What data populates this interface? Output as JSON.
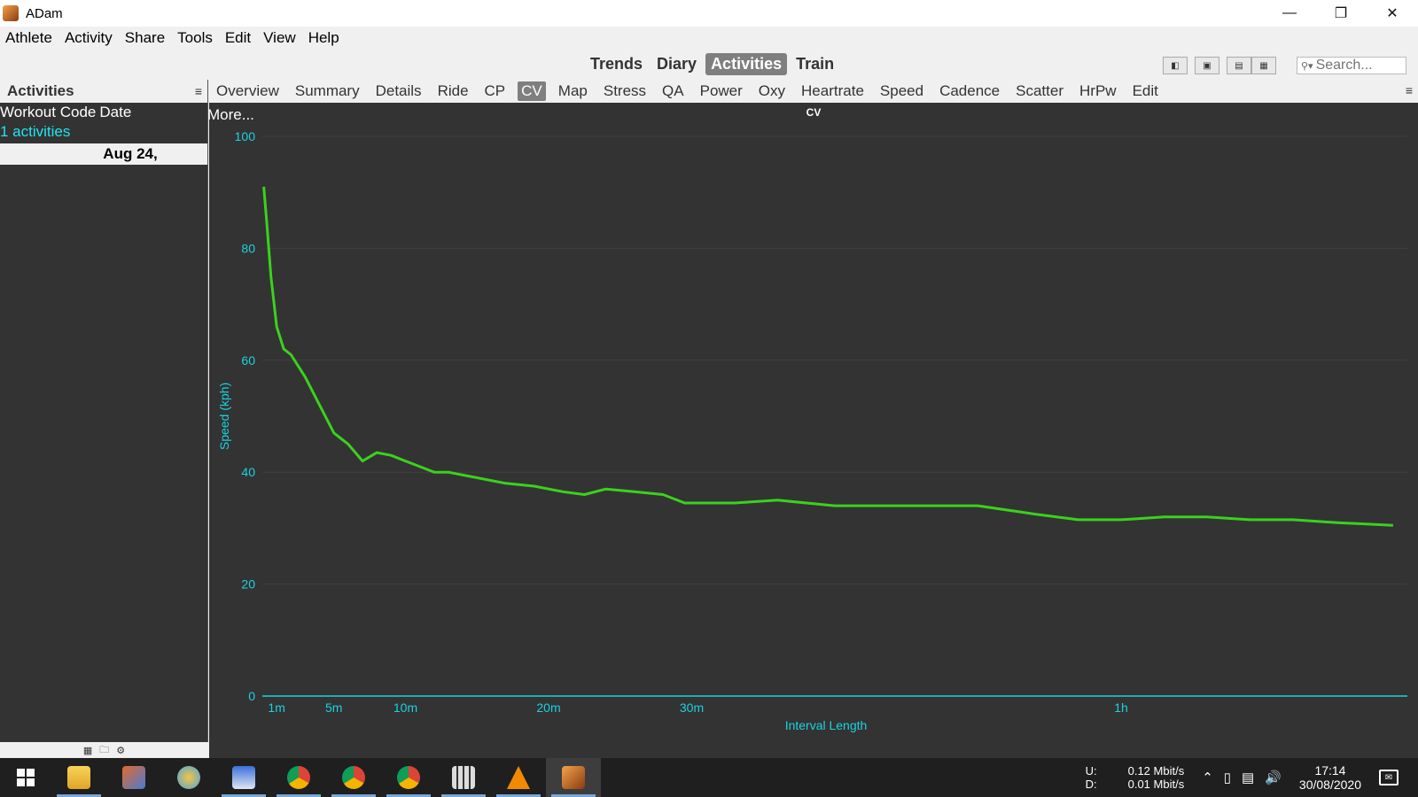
{
  "window": {
    "title": "ADam"
  },
  "menu": [
    "Athlete",
    "Activity",
    "Share",
    "Tools",
    "Edit",
    "View",
    "Help"
  ],
  "views": [
    {
      "label": "Trends",
      "active": false
    },
    {
      "label": "Diary",
      "active": false
    },
    {
      "label": "Activities",
      "active": true
    },
    {
      "label": "Train",
      "active": false
    }
  ],
  "search": {
    "placeholder": "Search..."
  },
  "sidebar": {
    "title": "Activities",
    "columns": [
      "Workout Code",
      "Date"
    ],
    "count_label": "1 activities",
    "selected_date": "Aug 24,"
  },
  "chart_tabs": [
    {
      "label": "Overview",
      "active": false
    },
    {
      "label": "Summary",
      "active": false
    },
    {
      "label": "Details",
      "active": false
    },
    {
      "label": "Ride",
      "active": false
    },
    {
      "label": "CP",
      "active": false
    },
    {
      "label": "CV",
      "active": true
    },
    {
      "label": "Map",
      "active": false
    },
    {
      "label": "Stress",
      "active": false
    },
    {
      "label": "QA",
      "active": false
    },
    {
      "label": "Power",
      "active": false
    },
    {
      "label": "Oxy",
      "active": false
    },
    {
      "label": "Heartrate",
      "active": false
    },
    {
      "label": "Speed",
      "active": false
    },
    {
      "label": "Cadence",
      "active": false
    },
    {
      "label": "Scatter",
      "active": false
    },
    {
      "label": "HrPw",
      "active": false
    },
    {
      "label": "Edit",
      "active": false
    }
  ],
  "chart_panel": {
    "more_label": "More..."
  },
  "colors": {
    "line": "#3ad21c",
    "axis": "#19d3e0",
    "background": "#333333"
  },
  "chart_data": {
    "type": "line",
    "title": "CV",
    "xlabel": "Interval Length",
    "ylabel": "Speed (kph)",
    "ylim": [
      0,
      100
    ],
    "yticks": [
      0,
      20,
      40,
      60,
      80,
      100
    ],
    "xticks": [
      {
        "label": "1m",
        "minutes": 1
      },
      {
        "label": "5m",
        "minutes": 5
      },
      {
        "label": "10m",
        "minutes": 10
      },
      {
        "label": "20m",
        "minutes": 20
      },
      {
        "label": "30m",
        "minutes": 30
      },
      {
        "label": "1h",
        "minutes": 60
      }
    ],
    "series": [
      {
        "x_minutes": [
          0.1,
          0.3,
          0.6,
          1.0,
          1.5,
          2.0,
          3.0,
          4.0,
          5.0,
          6.0,
          7.0,
          8.0,
          9.0,
          10.0,
          11.0,
          12.0,
          13.0,
          14.0,
          15.0,
          17.0,
          19.0,
          21.0,
          22.5,
          24.0,
          26.0,
          28.0,
          29.5,
          31.0,
          33.0,
          36.0,
          40.0,
          43.0,
          46.0,
          50.0,
          54.0,
          57.0,
          60.0,
          63.0,
          66.0,
          69.0,
          72.0,
          75.0,
          79.0
        ],
        "values": [
          91,
          85,
          75,
          66,
          62,
          61,
          57,
          52,
          47,
          45,
          42,
          43.5,
          43,
          42,
          41,
          40,
          40,
          39.5,
          39,
          38,
          37.5,
          36.5,
          36,
          37,
          36.5,
          36,
          34.5,
          34.5,
          34.5,
          35,
          34,
          34,
          34,
          34,
          32.5,
          31.5,
          31.5,
          32,
          32,
          31.5,
          31.5,
          31,
          30.5
        ]
      }
    ]
  },
  "taskbar": {
    "net_up_label": "U:",
    "net_up": "0.12 Mbit/s",
    "net_down_label": "D:",
    "net_down": "0.01 Mbit/s",
    "time": "17:14",
    "date": "30/08/2020"
  }
}
